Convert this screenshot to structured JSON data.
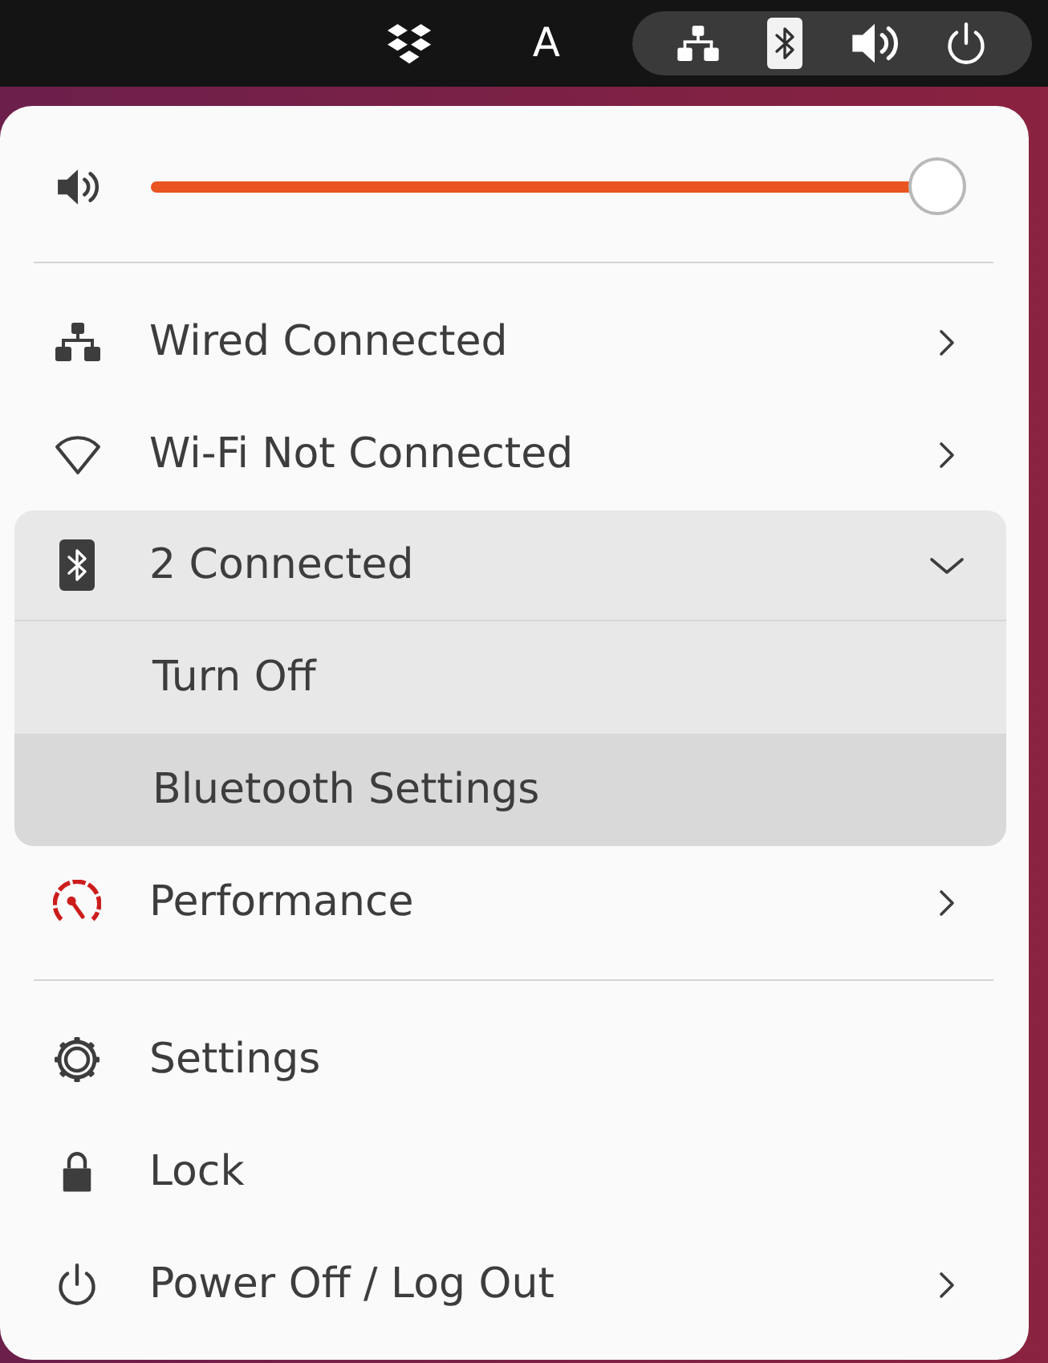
{
  "top_bar": {
    "input_source": "A"
  },
  "menu": {
    "volume": {
      "level": 1
    },
    "sections": [
      {
        "items": [
          {
            "kind": "submenu",
            "label": "Wired Connected",
            "expanded": false
          },
          {
            "kind": "submenu",
            "label": "Wi-Fi Not Connected",
            "expanded": false
          },
          {
            "kind": "submenu",
            "label": "2 Connected",
            "expanded": true,
            "children": [
              {
                "label": "Turn Off",
                "selected": false
              },
              {
                "label": "Bluetooth Settings",
                "selected": true
              }
            ]
          },
          {
            "kind": "submenu",
            "label": "Performance",
            "expanded": false
          }
        ]
      },
      {
        "items": [
          {
            "kind": "action",
            "label": "Settings"
          },
          {
            "kind": "action",
            "label": "Lock"
          },
          {
            "kind": "submenu",
            "label": "Power Off / Log Out",
            "expanded": false
          }
        ]
      }
    ]
  }
}
